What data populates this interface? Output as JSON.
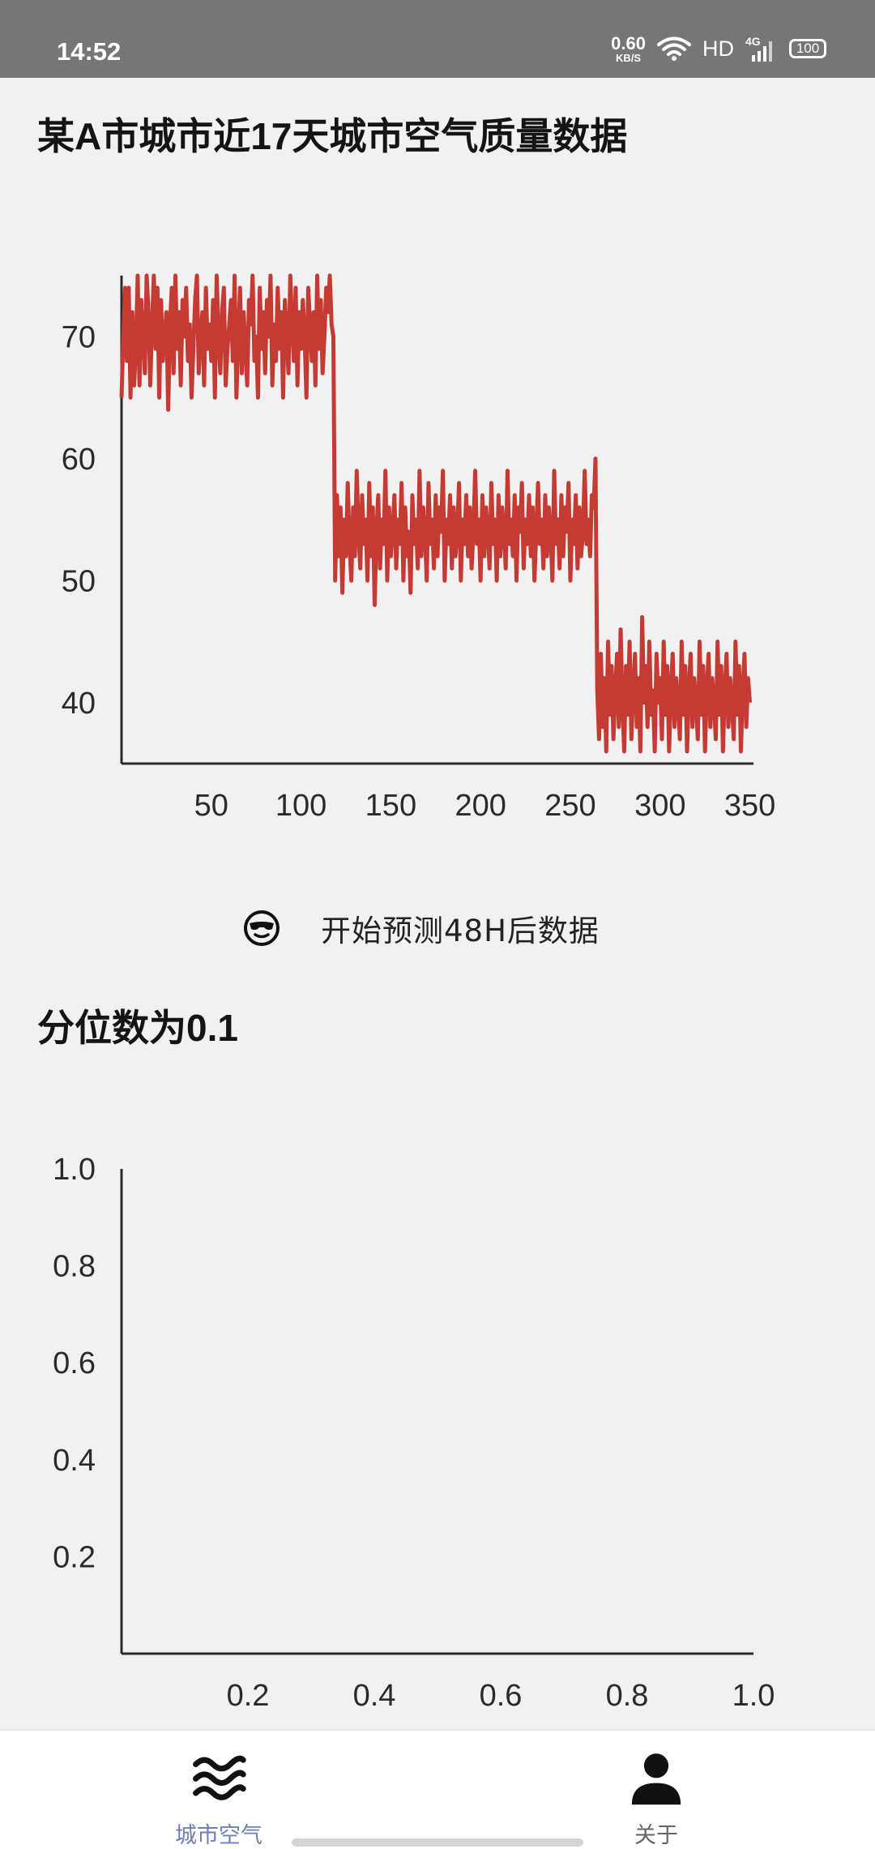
{
  "status_bar": {
    "time": "14:52",
    "net_speed_value": "0.60",
    "net_speed_unit": "KB/S",
    "wifi_icon": "wifi-icon",
    "hd_label": "HD",
    "network_type": "4G",
    "battery_level": "100"
  },
  "section1": {
    "title": "某A市城市近17天城市空气质量数据"
  },
  "predict_button": {
    "icon": "sunglasses-face-emoji",
    "label": "开始预测48H后数据"
  },
  "section2": {
    "title": "分位数为0.1"
  },
  "bottom_nav": {
    "items": [
      {
        "label": "城市空气",
        "icon": "waves-icon",
        "active": true
      },
      {
        "label": "关于",
        "icon": "person-icon",
        "active": false
      }
    ]
  },
  "colors": {
    "line": "#c53a33",
    "active_tab": "#6f7fb8",
    "background": "#f2f1f2"
  },
  "chart_data": [
    {
      "type": "line",
      "title": "",
      "xlabel": "",
      "ylabel": "",
      "xlim": [
        0,
        352
      ],
      "ylim": [
        35,
        75
      ],
      "x_ticks": [
        50,
        100,
        150,
        200,
        250,
        300,
        350
      ],
      "y_ticks": [
        40,
        50,
        60,
        70
      ],
      "grid": false,
      "segments": [
        {
          "x_start": 0,
          "x_end": 118,
          "mean": 70,
          "min": 64,
          "max": 75
        },
        {
          "x_start": 119,
          "x_end": 264,
          "mean": 55,
          "min": 48,
          "max": 61
        },
        {
          "x_start": 265,
          "x_end": 350,
          "mean": 40,
          "min": 35,
          "max": 47
        }
      ],
      "series": [
        {
          "values": [
            65,
            70,
            74,
            68,
            74,
            65,
            72,
            66,
            69,
            75,
            66,
            73,
            70,
            67,
            75,
            72,
            66,
            71,
            75,
            69,
            74,
            65,
            73,
            68,
            70,
            72,
            64,
            71,
            74,
            67,
            75,
            69,
            72,
            66,
            73,
            70,
            74,
            68,
            71,
            65,
            69,
            73,
            75,
            67,
            70,
            72,
            66,
            74,
            69,
            71,
            68,
            73,
            65,
            75,
            70,
            67,
            72,
            74,
            66,
            69,
            71,
            73,
            68,
            75,
            65,
            70,
            74,
            67,
            72,
            69,
            66,
            73,
            71,
            75,
            68,
            70,
            65,
            74,
            69,
            72,
            67,
            73,
            70,
            75,
            66,
            71,
            68,
            74,
            69,
            72,
            65,
            73,
            70,
            67,
            75,
            71,
            68,
            74,
            66,
            72,
            69,
            73,
            70,
            65,
            74,
            71,
            68,
            72,
            66,
            75,
            69,
            73,
            67,
            70,
            74,
            72,
            75,
            71,
            70,
            50,
            57,
            52,
            56,
            49,
            55,
            52,
            58,
            53,
            50,
            56,
            52,
            59,
            54,
            51,
            57,
            53,
            55,
            50,
            58,
            52,
            56,
            48,
            54,
            57,
            51,
            55,
            53,
            59,
            50,
            56,
            52,
            54,
            57,
            51,
            55,
            53,
            58,
            50,
            56,
            52,
            54,
            49,
            57,
            53,
            55,
            51,
            59,
            52,
            56,
            54,
            50,
            58,
            53,
            55,
            51,
            57,
            52,
            56,
            54,
            59,
            50,
            55,
            53,
            57,
            51,
            56,
            52,
            54,
            58,
            50,
            55,
            53,
            57,
            52,
            56,
            51,
            54,
            59,
            53,
            55,
            50,
            57,
            52,
            56,
            54,
            51,
            58,
            53,
            55,
            50,
            57,
            52,
            56,
            54,
            51,
            59,
            53,
            55,
            52,
            57,
            50,
            56,
            54,
            58,
            51,
            55,
            53,
            57,
            52,
            56,
            50,
            54,
            58,
            53,
            55,
            51,
            57,
            52,
            56,
            54,
            50,
            59,
            53,
            55,
            51,
            57,
            52,
            56,
            54,
            58,
            50,
            55,
            53,
            57,
            51,
            56,
            52,
            54,
            59,
            53,
            55,
            52,
            57,
            56,
            60,
            41,
            37,
            44,
            38,
            42,
            36,
            45,
            39,
            43,
            37,
            41,
            44,
            38,
            46,
            40,
            36,
            43,
            39,
            45,
            37,
            41,
            44,
            38,
            42,
            36,
            47,
            40,
            43,
            38,
            45,
            39,
            41,
            36,
            44,
            40,
            42,
            37,
            45,
            39,
            43,
            36,
            41,
            44,
            38,
            42,
            40,
            37,
            45,
            39,
            43,
            36,
            41,
            44,
            38,
            42,
            40,
            37,
            45,
            39,
            43,
            36,
            41,
            44,
            38,
            42,
            40,
            37,
            45,
            39,
            43,
            36,
            41,
            44,
            38,
            42,
            40,
            37,
            45,
            39,
            43,
            36,
            41,
            44,
            38,
            42,
            40
          ]
        }
      ]
    },
    {
      "type": "line",
      "title": "",
      "xlabel": "",
      "ylabel": "",
      "xlim": [
        0,
        1.0
      ],
      "ylim": [
        0,
        1.0
      ],
      "x_ticks": [
        0.2,
        0.4,
        0.6,
        0.8,
        1.0
      ],
      "y_ticks": [
        0.2,
        0.4,
        0.6,
        0.8,
        1.0
      ],
      "x_tick_labels": [
        "0.2",
        "0.4",
        "0.6",
        "0.8",
        "1.0"
      ],
      "y_tick_labels": [
        "0.2",
        "0.4",
        "0.6",
        "0.8",
        "1.0"
      ],
      "grid": false,
      "series": []
    }
  ]
}
